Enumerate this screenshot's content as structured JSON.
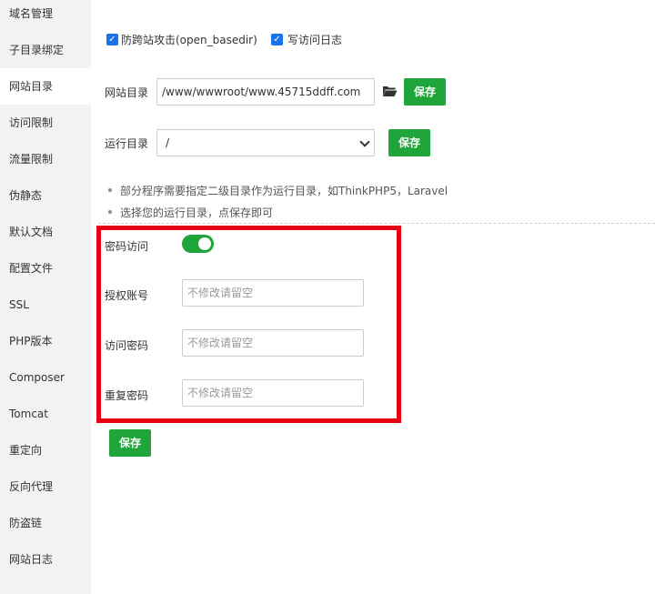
{
  "sidebar": {
    "items": [
      {
        "label": "域名管理"
      },
      {
        "label": "子目录绑定"
      },
      {
        "label": "网站目录",
        "active": true
      },
      {
        "label": "访问限制"
      },
      {
        "label": "流量限制"
      },
      {
        "label": "伪静态"
      },
      {
        "label": "默认文档"
      },
      {
        "label": "配置文件"
      },
      {
        "label": "SSL"
      },
      {
        "label": "PHP版本"
      },
      {
        "label": "Composer"
      },
      {
        "label": "Tomcat"
      },
      {
        "label": "重定向"
      },
      {
        "label": "反向代理"
      },
      {
        "label": "防盗链"
      },
      {
        "label": "网站日志"
      }
    ]
  },
  "options": {
    "anti_cross_site": {
      "label": "防跨站攻击(open_basedir)",
      "checked": true
    },
    "write_access_log": {
      "label": "写访问日志",
      "checked": true
    }
  },
  "site_dir": {
    "label": "网站目录",
    "value": "/www/wwwroot/www.45715ddff.com",
    "folder_icon": "folder-open-icon",
    "save_label": "保存"
  },
  "run_dir": {
    "label": "运行目录",
    "value": "/",
    "save_label": "保存"
  },
  "hints": [
    "部分程序需要指定二级目录作为运行目录，如ThinkPHP5，Laravel",
    "选择您的运行目录，点保存即可"
  ],
  "password_access": {
    "toggle_label": "密码访问",
    "enabled": true,
    "auth_account": {
      "label": "授权账号",
      "placeholder": "不修改请留空"
    },
    "access_password": {
      "label": "访问密码",
      "placeholder": "不修改请留空"
    },
    "repeat_password": {
      "label": "重复密码",
      "placeholder": "不修改请留空"
    },
    "save_label": "保存"
  },
  "colors": {
    "accent_green": "#20a53a",
    "checkbox_blue": "#1a73e8",
    "highlight_red": "#e60012",
    "sidebar_bg": "#f2f2f2"
  }
}
